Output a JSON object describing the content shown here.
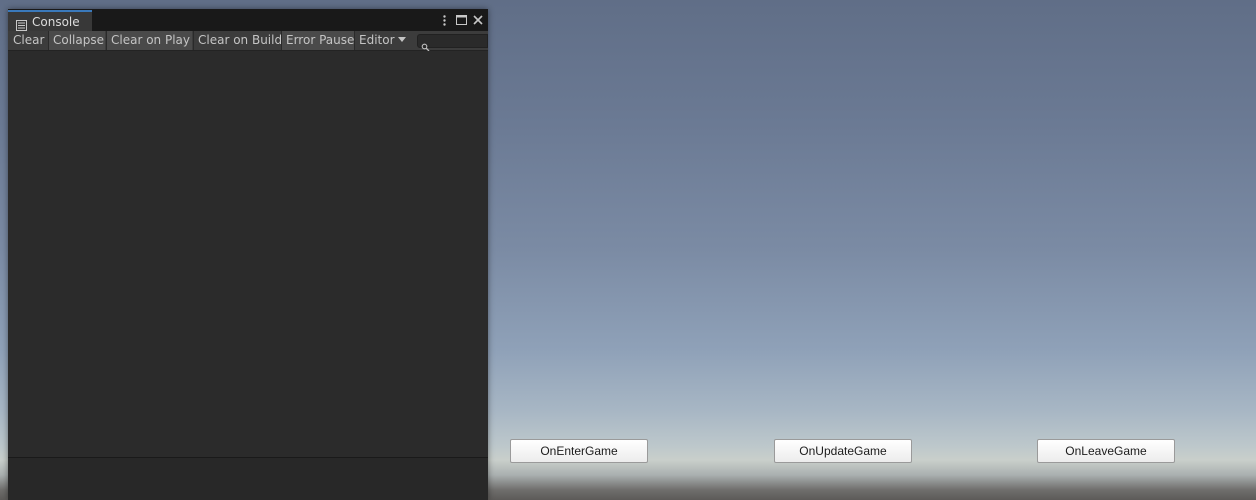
{
  "console": {
    "tab_title": "Console",
    "tab_icon": "console-list-icon",
    "window_menu_icon": "kebab-menu-icon",
    "maximize_icon": "maximize-icon",
    "close_icon": "close-icon",
    "toolbar": {
      "clear": "Clear",
      "collapse": "Collapse",
      "clear_on_play": "Clear on Play",
      "clear_on_build": "Clear on Build",
      "error_pause": "Error Pause",
      "editor": "Editor"
    },
    "toggles": {
      "collapse": true,
      "clear_on_play": true,
      "clear_on_build": false,
      "error_pause": true
    },
    "search": {
      "value": "",
      "placeholder": ""
    },
    "accent_color": "#3a79bb"
  },
  "game": {
    "buttons": [
      {
        "label": "OnEnterGame"
      },
      {
        "label": "OnUpdateGame"
      },
      {
        "label": "OnLeaveGame"
      }
    ]
  }
}
